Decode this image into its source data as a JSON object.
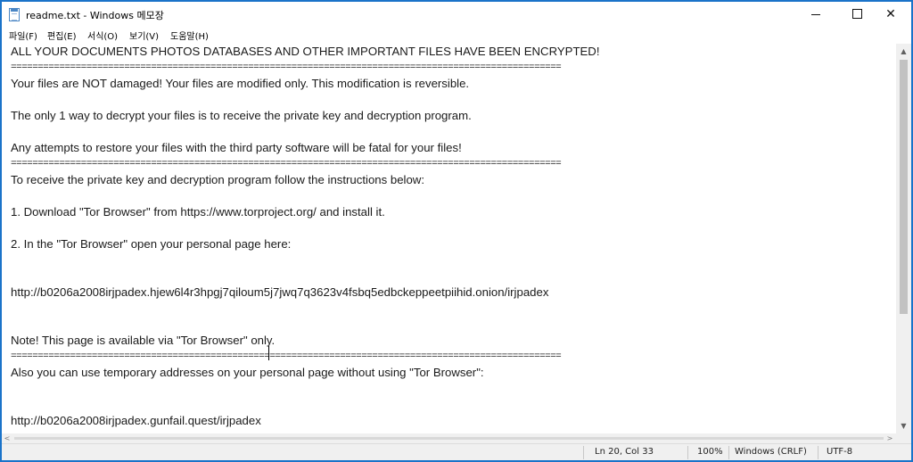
{
  "window": {
    "title": "readme.txt - Windows 메모장",
    "controls": {
      "minimize_icon": "minimize-icon",
      "maximize_icon": "maximize-icon",
      "close_glyph": "✕"
    }
  },
  "menu": {
    "items": [
      "파일(F)",
      "편집(E)",
      "서식(O)",
      "보기(V)",
      "도움말(H)"
    ]
  },
  "document": {
    "lines": [
      "ALL YOUR DOCUMENTS PHOTOS DATABASES AND OTHER IMPORTANT FILES HAVE BEEN ENCRYPTED!",
      "======================================================================================================",
      "Your files are NOT damaged! Your files are modified only. This modification is reversible.",
      "",
      "The only 1 way to decrypt your files is to receive the private key and decryption program.",
      "",
      "Any attempts to restore your files with the third party software will be fatal for your files!",
      "======================================================================================================",
      "To receive the private key and decryption program follow the instructions below:",
      "",
      "1. Download \"Tor Browser\" from https://www.torproject.org/ and install it.",
      "",
      "2. In the \"Tor Browser\" open your personal page here:",
      "",
      "",
      "http://b0206a2008irjpadex.hjew6l4r3hpgj7qiloum5j7jwq7q3623v4fsbq5edbckeppeetpiihid.onion/irjpadex",
      "",
      "",
      "Note! This page is available via \"Tor Browser\" only.",
      "======================================================================================================",
      "Also you can use temporary addresses on your personal page without using \"Tor Browser\":",
      "",
      "",
      "http://b0206a2008irjpadex.gunfail.quest/irjpadex"
    ]
  },
  "status": {
    "position": "Ln 20, Col 33",
    "zoom": "100%",
    "line_ending": "Windows (CRLF)",
    "encoding": "UTF-8"
  },
  "scrollbars": {
    "vertical_up_glyph": "▲",
    "vertical_down_glyph": "▼",
    "horizontal_left_glyph": "<",
    "horizontal_right_glyph": ">"
  }
}
